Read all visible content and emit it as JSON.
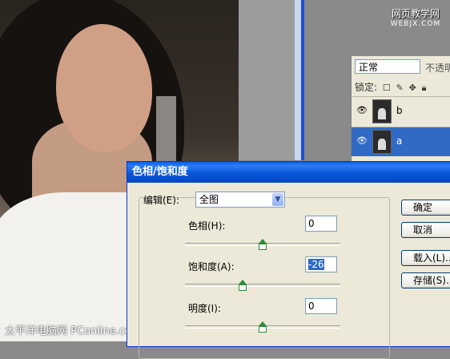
{
  "brand": {
    "line1": "网页教学网",
    "line2": "WEBJX.COM"
  },
  "photo": {
    "watermark": "太平洋电脑网 PConline.com.cn"
  },
  "layers_panel": {
    "blend_mode": "正常",
    "opacity_label": "不透明",
    "lock_label": "锁定:",
    "layers": [
      {
        "name": "b",
        "selected": false
      },
      {
        "name": "a",
        "selected": true
      }
    ]
  },
  "dialog": {
    "title": "色相/饱和度",
    "edit_label": "编辑(E):",
    "edit_value": "全图",
    "params": [
      {
        "label": "色相(H):",
        "value": "0",
        "position": 0.5
      },
      {
        "label": "饱和度(A):",
        "value": "-26",
        "position": 0.37
      },
      {
        "label": "明度(I):",
        "value": "0",
        "position": 0.5
      }
    ],
    "buttons": {
      "ok": "确定",
      "cancel": "取消",
      "load": "载入(L)...",
      "save": "存储(S)..."
    }
  },
  "colors": {
    "title_bar": "#0a5ee8",
    "selection": "#316ac5",
    "slider": "#2e8b3a"
  }
}
